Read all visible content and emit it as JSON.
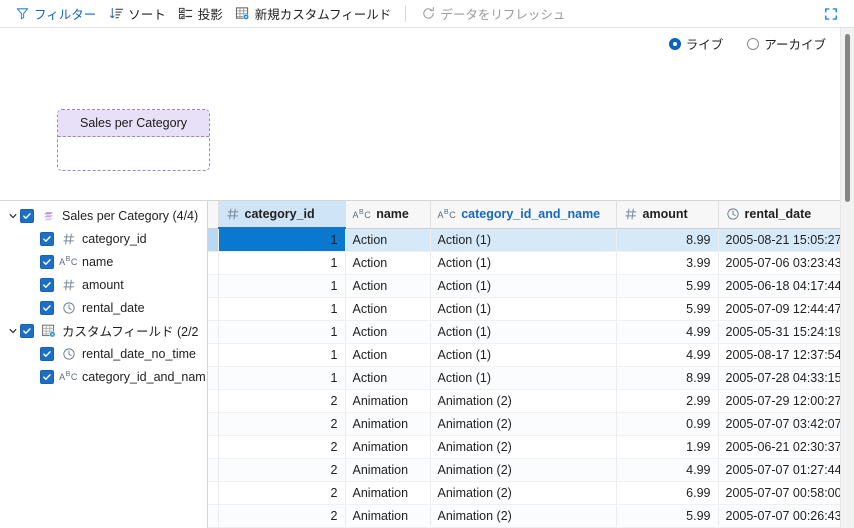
{
  "toolbar": {
    "filter_label": "フィルター",
    "sort_label": "ソート",
    "projection_label": "投影",
    "new_custom_field_label": "新規カスタムフィールド",
    "refresh_label": "データをリフレッシュ",
    "expand_icon": "expand-icon"
  },
  "canvas": {
    "radio": {
      "live_label": "ライブ",
      "archive_label": "アーカイブ",
      "selected": "ライブ"
    },
    "card": {
      "title": "Sales per Category"
    }
  },
  "sidebar": {
    "nodes": [
      {
        "label": "Sales per Category (4/4)",
        "icon": "dataset-icon",
        "checked": true,
        "expanded": true,
        "children": [
          {
            "label": "category_id",
            "icon": "number-type-icon",
            "checked": true
          },
          {
            "label": "name",
            "icon": "text-type-icon",
            "checked": true
          },
          {
            "label": "amount",
            "icon": "number-type-icon",
            "checked": true
          },
          {
            "label": "rental_date",
            "icon": "date-type-icon",
            "checked": true
          }
        ]
      },
      {
        "label": "カスタムフィールド (2/2",
        "icon": "custom-field-icon",
        "checked": true,
        "expanded": true,
        "children": [
          {
            "label": "rental_date_no_time",
            "icon": "date-type-icon",
            "checked": true
          },
          {
            "label": "category_id_and_name",
            "icon": "text-type-icon",
            "checked": true
          }
        ]
      }
    ]
  },
  "table": {
    "columns": [
      {
        "label": "category_id",
        "type_icon": "number-type-icon",
        "accent": false,
        "selected": true
      },
      {
        "label": "name",
        "type_icon": "text-type-icon",
        "accent": false,
        "selected": false
      },
      {
        "label": "category_id_and_name",
        "type_icon": "text-type-icon",
        "accent": true,
        "selected": false
      },
      {
        "label": "amount",
        "type_icon": "number-type-icon",
        "accent": false,
        "selected": false
      },
      {
        "label": "rental_date",
        "type_icon": "date-type-icon",
        "accent": false,
        "selected": false
      }
    ],
    "rows": [
      {
        "category_id": "1",
        "name": "Action",
        "category_id_and_name": "Action (1)",
        "amount": "8.99",
        "rental_date": "2005-08-21 15:05:27"
      },
      {
        "category_id": "1",
        "name": "Action",
        "category_id_and_name": "Action (1)",
        "amount": "3.99",
        "rental_date": "2005-07-06 03:23:43"
      },
      {
        "category_id": "1",
        "name": "Action",
        "category_id_and_name": "Action (1)",
        "amount": "5.99",
        "rental_date": "2005-06-18 04:17:44"
      },
      {
        "category_id": "1",
        "name": "Action",
        "category_id_and_name": "Action (1)",
        "amount": "5.99",
        "rental_date": "2005-07-09 12:44:47"
      },
      {
        "category_id": "1",
        "name": "Action",
        "category_id_and_name": "Action (1)",
        "amount": "4.99",
        "rental_date": "2005-05-31 15:24:19"
      },
      {
        "category_id": "1",
        "name": "Action",
        "category_id_and_name": "Action (1)",
        "amount": "4.99",
        "rental_date": "2005-08-17 12:37:54"
      },
      {
        "category_id": "1",
        "name": "Action",
        "category_id_and_name": "Action (1)",
        "amount": "8.99",
        "rental_date": "2005-07-28 04:33:15"
      },
      {
        "category_id": "2",
        "name": "Animation",
        "category_id_and_name": "Animation (2)",
        "amount": "2.99",
        "rental_date": "2005-07-29 12:00:27"
      },
      {
        "category_id": "2",
        "name": "Animation",
        "category_id_and_name": "Animation (2)",
        "amount": "0.99",
        "rental_date": "2005-07-07 03:42:07"
      },
      {
        "category_id": "2",
        "name": "Animation",
        "category_id_and_name": "Animation (2)",
        "amount": "1.99",
        "rental_date": "2005-06-21 02:30:37"
      },
      {
        "category_id": "2",
        "name": "Animation",
        "category_id_and_name": "Animation (2)",
        "amount": "4.99",
        "rental_date": "2005-07-07 01:27:44"
      },
      {
        "category_id": "2",
        "name": "Animation",
        "category_id_and_name": "Animation (2)",
        "amount": "6.99",
        "rental_date": "2005-07-07 00:58:00"
      },
      {
        "category_id": "2",
        "name": "Animation",
        "category_id_and_name": "Animation (2)",
        "amount": "5.99",
        "rental_date": "2005-07-07 00:26:43"
      }
    ],
    "selected_row_index": 0,
    "selected_column": "category_id"
  },
  "colors": {
    "accent_blue": "#1569c4",
    "selection_blue": "#0b78d0",
    "selection_row": "#d6e9f9",
    "card_header": "#e7e0f7",
    "card_border": "#9a86c4"
  }
}
